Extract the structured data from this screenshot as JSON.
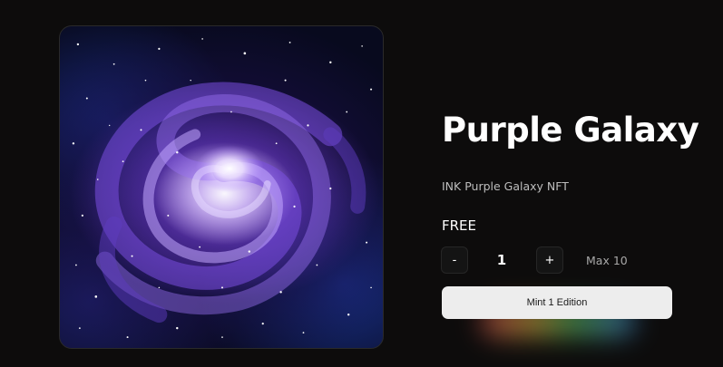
{
  "artwork": {
    "alt": "Purple Galaxy artwork",
    "colors": {
      "core": "#ffffff",
      "arm": "#8a5cf0",
      "space": "#080a1e",
      "edge": "#2a3aa8"
    }
  },
  "product": {
    "title": "Purple Galaxy",
    "subtitle": "INK Purple Galaxy NFT",
    "price": "FREE"
  },
  "quantity": {
    "decrement_label": "-",
    "value": "1",
    "increment_label": "+",
    "max_label": "Max 10"
  },
  "mint": {
    "button_label": "Mint 1 Edition"
  },
  "theme": {
    "background": "#0d0c0c",
    "button_bg": "#ededed"
  }
}
